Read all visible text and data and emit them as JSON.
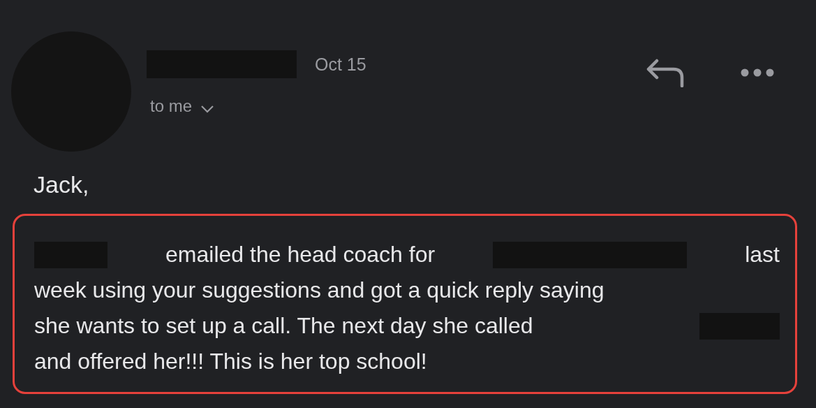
{
  "header": {
    "date": "Oct 15",
    "recipient": "to me"
  },
  "greeting": "Jack,",
  "body_lines": [
    [
      {
        "kind": "redacted"
      },
      {
        "kind": "text",
        "text": "emailed the head coach for"
      },
      {
        "kind": "redacted"
      },
      {
        "kind": "text",
        "text": "last"
      }
    ],
    [
      {
        "kind": "text",
        "text": "week using your suggestions and got a quick reply saying"
      }
    ],
    [
      {
        "kind": "text",
        "text": "she wants to set up a call. The next day she called"
      },
      {
        "kind": "redacted"
      }
    ],
    [
      {
        "kind": "text",
        "text": "and offered her!!! This is her top school!"
      }
    ]
  ]
}
